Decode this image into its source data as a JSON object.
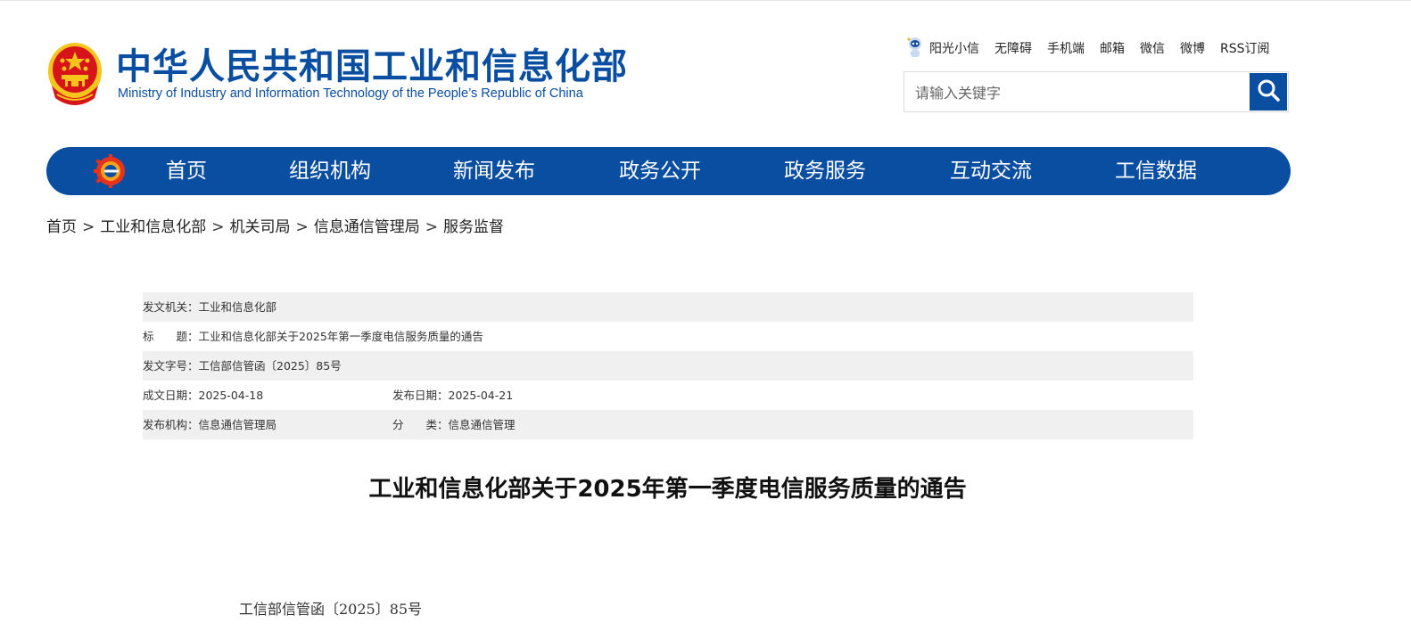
{
  "header": {
    "title_cn": "中华人民共和国工业和信息化部",
    "title_en": "Ministry of Industry and Information Technology of the People’s Republic of China",
    "quick_links": [
      "阳光小信",
      "无障碍",
      "手机端",
      "邮箱",
      "微信",
      "微博",
      "RSS订阅"
    ],
    "search_placeholder": "请输入关键字"
  },
  "nav": {
    "items": [
      "首页",
      "组织机构",
      "新闻发布",
      "政务公开",
      "政务服务",
      "互动交流",
      "工信数据"
    ]
  },
  "breadcrumb": [
    "首页",
    "工业和信息化部",
    "机关司局",
    "信息通信管理局",
    "服务监督"
  ],
  "info": {
    "issuer": "发文机关：工业和信息化部",
    "title": "标　　题：工业和信息化部关于2025年第一季度电信服务质量的通告",
    "doc_no": "发文字号：工信部信管函〔2025〕85号",
    "created_date": "成文日期：2025-04-18",
    "published_date": "发布日期：2025-04-21",
    "publisher": "发布机构：信息通信管理局",
    "category": "分　　类：信息通信管理"
  },
  "document": {
    "title": "工业和信息化部关于2025年第一季度电信服务质量的通告",
    "number": "工信部信管函〔2025〕85号"
  },
  "colors": {
    "brand_blue": "#0a4ea2",
    "emblem_red": "#d7141a",
    "emblem_gold": "#f5c51c"
  },
  "icons": {
    "emblem": "national-emblem-icon",
    "robot": "robot-assistant-icon",
    "search": "search-icon",
    "nav_logo": "miit-logo-icon"
  }
}
